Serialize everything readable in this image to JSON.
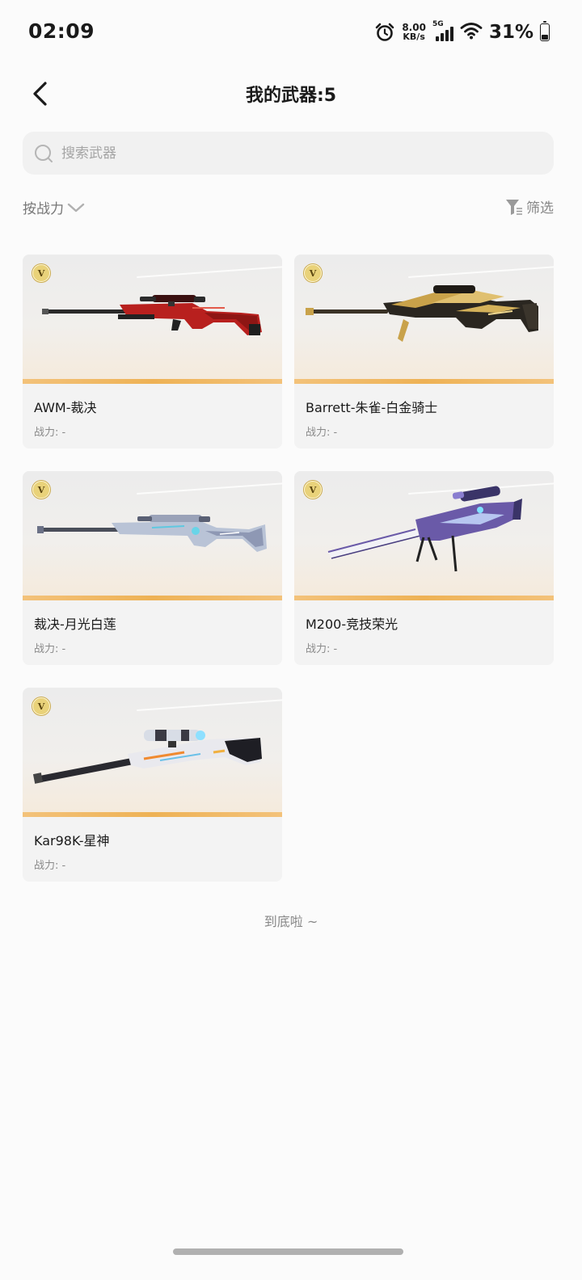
{
  "status_bar": {
    "time": "02:09",
    "net_speed_value": "8.00",
    "net_speed_unit": "KB/s",
    "network_type": "5G",
    "battery_percent": "31%",
    "battery_level": 0.31
  },
  "header": {
    "title": "我的武器:5"
  },
  "search": {
    "placeholder": "搜索武器",
    "value": ""
  },
  "sort": {
    "label": "按战力"
  },
  "filter": {
    "label": "筛选"
  },
  "weapons": [
    {
      "name": "AWM-裁决",
      "power": "战力: -",
      "badge": "V"
    },
    {
      "name": "Barrett-朱雀-白金骑士",
      "power": "战力: -",
      "badge": "V"
    },
    {
      "name": "裁决-月光白莲",
      "power": "战力: -",
      "badge": "V"
    },
    {
      "name": "M200-竞技荣光",
      "power": "战力: -",
      "badge": "V"
    },
    {
      "name": "Kar98K-星神",
      "power": "战力: -",
      "badge": "V"
    }
  ],
  "footer": {
    "end_text": "到底啦 ~"
  },
  "colors": {
    "card_accent": "#eeb255",
    "awm_body": "#b8201e",
    "barrett_gold": "#c9a24a",
    "moonlight_silver": "#b9c3d6",
    "m200_purple": "#6a5aa8",
    "kar98k_white": "#e9e9ee"
  }
}
